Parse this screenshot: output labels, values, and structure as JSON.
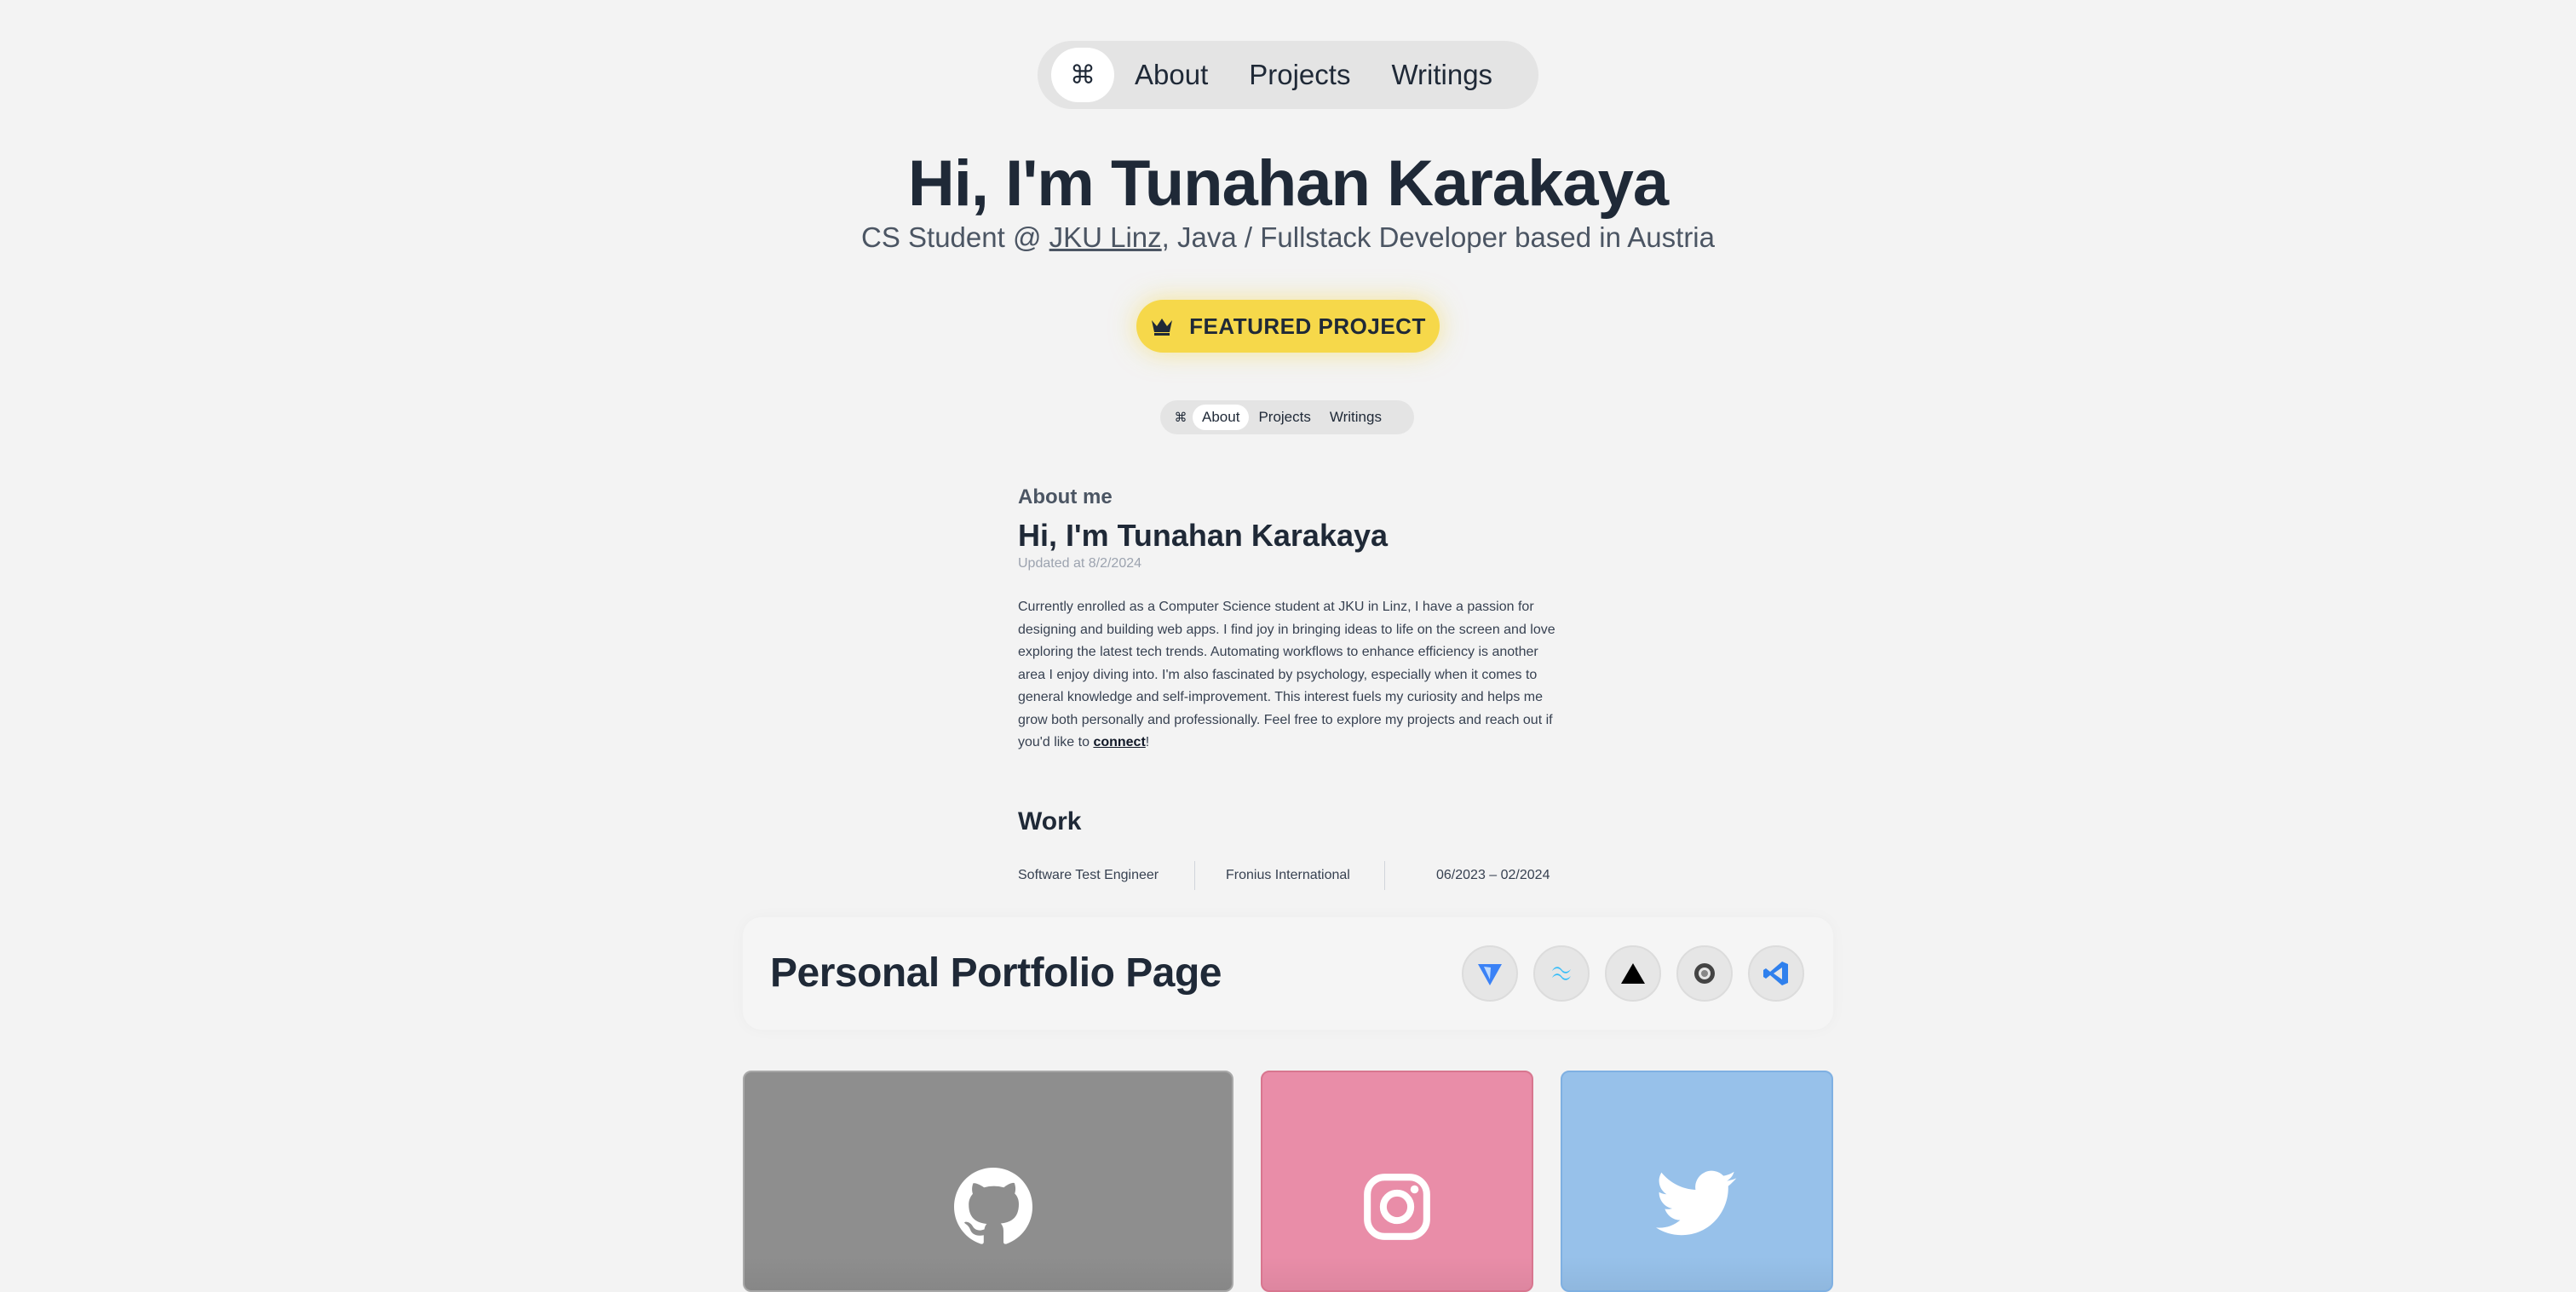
{
  "nav": {
    "cmd_glyph": "⌘",
    "items": [
      {
        "label": "About"
      },
      {
        "label": "Projects"
      },
      {
        "label": "Writings"
      }
    ]
  },
  "hero": {
    "title": "Hi, I'm Tunahan Karakaya",
    "subtitle_prefix": "CS Student @ ",
    "subtitle_link": "JKU Linz",
    "subtitle_suffix": ", Java / Fullstack Developer based in Austria"
  },
  "featured": {
    "label": "FEATURED PROJECT",
    "icon": "crown-icon"
  },
  "preview": {
    "nav": {
      "cmd_glyph": "⌘",
      "items": [
        {
          "label": "About",
          "active": true
        },
        {
          "label": "Projects"
        },
        {
          "label": "Writings"
        }
      ]
    },
    "about_label": "About me",
    "title": "Hi, I'm Tunahan Karakaya",
    "updated": "Updated at 8/2/2024",
    "body": "Currently enrolled as a Computer Science student at JKU in Linz, I have a passion for designing and building web apps. I find joy in bringing ideas to life on the screen and love exploring the latest tech trends. Automating workflows to enhance efficiency is another area I enjoy diving into. I'm also fascinated by psychology, especially when it comes to general knowledge and self-improvement. This interest fuels my curiosity and helps me grow both personally and professionally. Feel free to explore my projects and reach out if you'd like to ",
    "body_link": "connect",
    "body_end": "!",
    "work_title": "Work",
    "work": {
      "role": "Software Test Engineer",
      "company": "Fronius International",
      "period": "06/2023 – 02/2024"
    }
  },
  "project": {
    "title": "Personal Portfolio Page",
    "tech_icons": [
      "vite-icon",
      "tailwind-icon",
      "vercel-icon",
      "framer-motion-icon",
      "vscode-icon"
    ]
  },
  "socials": [
    {
      "name": "github-icon",
      "color": "#8e8e8e"
    },
    {
      "name": "instagram-icon",
      "color": "#e98da8"
    },
    {
      "name": "twitter-icon",
      "color": "#97c1ea"
    }
  ]
}
